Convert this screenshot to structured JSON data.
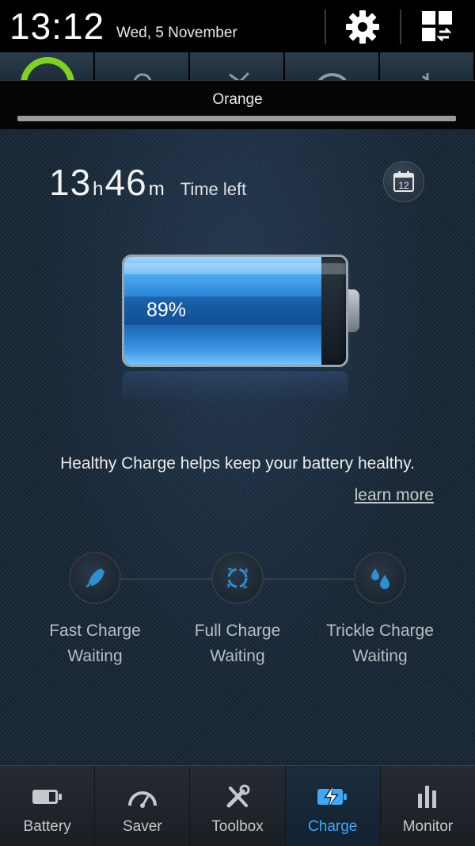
{
  "status_bar": {
    "time": "13:12",
    "date": "Wed, 5 November",
    "settings_icon": "gear-icon",
    "quick_panel_icon": "grid-toggle-icon"
  },
  "notification": {
    "carrier": "Orange"
  },
  "main": {
    "time_left": {
      "hours": "13",
      "hours_unit": "h",
      "minutes": "46",
      "minutes_unit": "m",
      "label": "Time left"
    },
    "calendar_button": {
      "icon": "calendar-icon",
      "day": "12"
    },
    "battery": {
      "percent_label": "89%",
      "level": 0.89,
      "color": "#2b86d8"
    },
    "healthy_text": "Healthy Charge helps keep your battery healthy.",
    "learn_more": "learn more",
    "stages": [
      {
        "name": "Fast Charge",
        "status": "Waiting",
        "icon": "rocket-icon"
      },
      {
        "name": "Full Charge",
        "status": "Waiting",
        "icon": "cycle-arrows-icon"
      },
      {
        "name": "Trickle Charge",
        "status": "Waiting",
        "icon": "droplets-icon"
      }
    ]
  },
  "nav": [
    {
      "label": "Battery",
      "icon": "battery-icon",
      "active": false
    },
    {
      "label": "Saver",
      "icon": "speedometer-icon",
      "active": false
    },
    {
      "label": "Toolbox",
      "icon": "tools-icon",
      "active": false
    },
    {
      "label": "Charge",
      "icon": "charge-bolt-icon",
      "active": true
    },
    {
      "label": "Monitor",
      "icon": "bar-chart-icon",
      "active": false
    }
  ],
  "colors": {
    "accent": "#3fa9f5",
    "background": "#172636"
  }
}
